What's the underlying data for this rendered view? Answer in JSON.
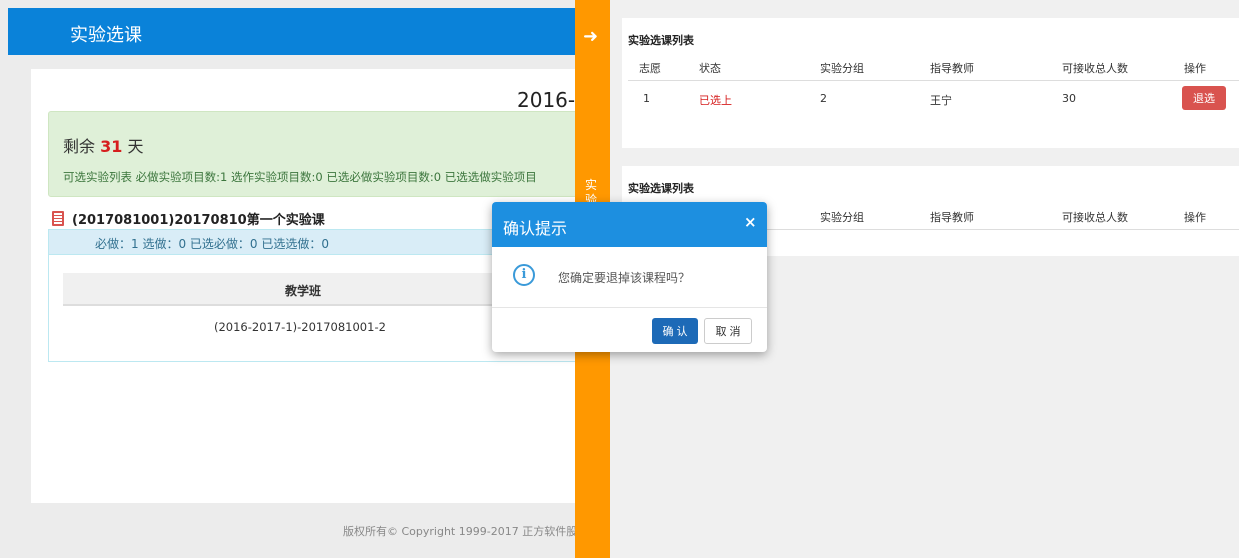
{
  "left": {
    "title": "实验选课",
    "year_partial": "2016-",
    "remaining_prefix": "剩余",
    "remaining_days": "31",
    "remaining_suffix": "天",
    "summary": "可选实验列表 必做实验项目数:1 选作实验项目数:0 已选必做实验项目数:0 已选选做实验项目",
    "course_title": "(2017081001)20170810第一个实验课",
    "stats": "必做：1 选做：0 已选必做：0 已选选做：0",
    "table_header": "教学班",
    "table_row": "(2016-2017-1)-2017081001-2",
    "footer": "版权所有© Copyright 1999-2017 正方软件股"
  },
  "orange_bar": {
    "arrow": "➜",
    "vertical_text": "实验"
  },
  "selected_table": {
    "title": "实验选课列表",
    "headers": [
      "志愿",
      "状态",
      "实验分组",
      "指导教师",
      "可接收总人数",
      "操作"
    ],
    "row": {
      "priority": "1",
      "status": "已选上",
      "group": "2",
      "teacher": "王宁",
      "capacity": "30",
      "action": "退选"
    }
  },
  "available_table": {
    "title": "实验选课列表",
    "headers": [
      "实验分组",
      "指导教师",
      "可接收总人数",
      "操作"
    ]
  },
  "modal": {
    "title": "确认提示",
    "close": "×",
    "message": "您确定要退掉该课程吗？",
    "icon": "i",
    "ok_label": "确 认",
    "cancel_label": "取 消"
  }
}
